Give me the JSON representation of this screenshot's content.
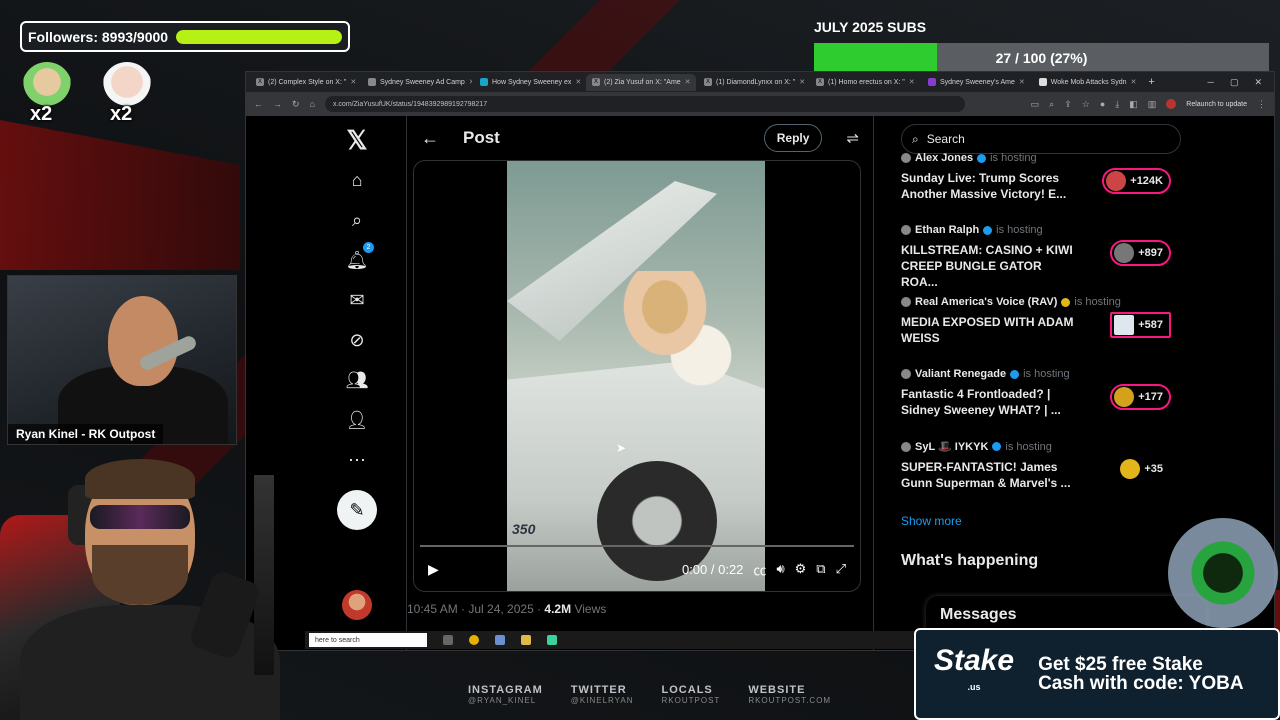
{
  "overlay": {
    "followers_label": "Followers: 8993/9000",
    "followers_progress": 0.999,
    "subs_title": "JULY 2025 SUBS",
    "subs_text": "27 / 100 (27%)",
    "subs_progress": 0.27,
    "multiplier_a": "x2",
    "multiplier_b": "x2",
    "cam_name": "Ryan Kinel - RK Outpost",
    "accent_green": "#b7f014",
    "subs_green": "#2ecc2e"
  },
  "browser": {
    "tabs": [
      {
        "label": "(2) Complex Style on X: \"",
        "active": false
      },
      {
        "label": "Sydney Sweeney Ad Camp",
        "active": false
      },
      {
        "label": "How Sydney Sweeney ex",
        "active": false
      },
      {
        "label": "(2) Zia Yusuf on X: \"Ame",
        "active": true
      },
      {
        "label": "(1) DiamondLynxx on X: \"",
        "active": false
      },
      {
        "label": "(1) Homo erectus on X: \"",
        "active": false
      },
      {
        "label": "Sydney Sweeney's Ame",
        "active": false
      },
      {
        "label": "Woke Mob Attacks Sydn",
        "active": false
      }
    ],
    "url": "x.com/ZiaYusufUK/status/1948392989192798217",
    "relaunch": "Relaunch to update"
  },
  "xnav": {
    "notif_count": "2"
  },
  "post": {
    "title": "Post",
    "reply_label": "Reply",
    "video_time": "0:00 / 0:22",
    "car_decal": "350",
    "timestamp": "10:45 AM · Jul 24, 2025 · ",
    "views": "4.2M",
    "views_label": " Views"
  },
  "sidebar": {
    "search_placeholder": "Search",
    "live": [
      {
        "host": "Alex Jones",
        "status": "is hosting",
        "title": "Sunday Live: Trump Scores Another Massive Victory! E...",
        "count": "+124K"
      },
      {
        "host": "Ethan Ralph",
        "status": "is hosting",
        "title": "KILLSTREAM: CASINO + KIWI CREEP BUNGLE GATOR ROA...",
        "count": "+897"
      },
      {
        "host": "Real America's Voice (RAV)",
        "status": "is hosting",
        "title": "MEDIA EXPOSED WITH ADAM WEISS",
        "count": "+587"
      },
      {
        "host": "Valiant Renegade",
        "status": "is hosting",
        "title": "Fantastic 4 Frontloaded? | Sidney Sweeney WHAT? | ...",
        "count": "+177"
      },
      {
        "host": "SyL 🎩 IYKYK",
        "status": "is hosting",
        "title": "SUPER-FANTASTIC! James Gunn Superman & Marvel's ...",
        "count": "+35"
      }
    ],
    "show_more": "Show more",
    "happening": "What's happening",
    "messages": "Messages"
  },
  "taskbar": {
    "search": "here to search"
  },
  "socials": [
    {
      "title": "INSTAGRAM",
      "handle": "@RYAN_KINEL"
    },
    {
      "title": "TWITTER",
      "handle": "@KINELRYAN"
    },
    {
      "title": "LOCALS",
      "handle": "RKOUTPOST"
    },
    {
      "title": "WEBSITE",
      "handle": "RKOUTPOST.COM"
    }
  ],
  "ad": {
    "brand": "Stake",
    "brand_suffix": ".us",
    "line1": "Get $25 free Stake",
    "line2": "Cash with code: YOBA"
  }
}
